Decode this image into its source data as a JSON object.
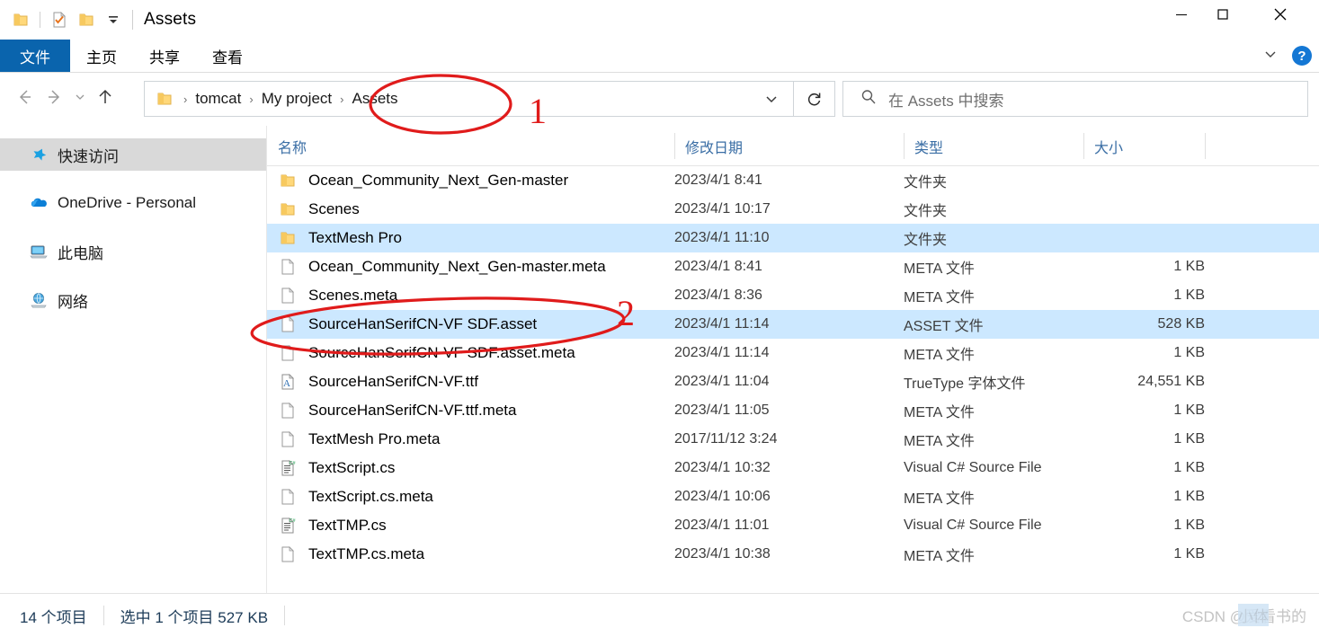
{
  "window": {
    "title": "Assets",
    "controls": {
      "minimize": "—",
      "maximize": "☐",
      "close": "✕"
    },
    "quick_access": {
      "folder_icon": "folder-icon",
      "properties_icon": "properties-icon",
      "new_folder_icon": "new-folder-icon",
      "customize_icon": "customize-dropdown-icon"
    }
  },
  "ribbon": {
    "tabs": [
      {
        "label": "文件",
        "active": true
      },
      {
        "label": "主页",
        "active": false
      },
      {
        "label": "共享",
        "active": false
      },
      {
        "label": "查看",
        "active": false
      }
    ],
    "collapse_icon": "chevron-down-icon",
    "help_label": "?",
    "accent_color": "#0a64ad"
  },
  "nav": {
    "back_icon": "arrow-left-icon",
    "forward_icon": "arrow-right-icon",
    "recent_icon": "chevron-down-icon",
    "up_icon": "arrow-up-icon",
    "breadcrumb": [
      "tomcat",
      "My project",
      "Assets"
    ],
    "breadcrumb_separator": "›",
    "address_dropdown_icon": "chevron-down-icon",
    "refresh_icon": "refresh-icon"
  },
  "search": {
    "icon": "search-icon",
    "placeholder": "在 Assets 中搜索",
    "value": ""
  },
  "sidebar": {
    "items": [
      {
        "label": "快速访问",
        "icon": "pin-star-icon",
        "selected": true
      },
      {
        "label": "OneDrive - Personal",
        "icon": "onedrive-cloud-icon",
        "selected": false
      },
      {
        "label": "此电脑",
        "icon": "this-pc-icon",
        "selected": false
      },
      {
        "label": "网络",
        "icon": "network-icon",
        "selected": false
      }
    ]
  },
  "filelist": {
    "columns": [
      {
        "key": "name",
        "label": "名称"
      },
      {
        "key": "date",
        "label": "修改日期"
      },
      {
        "key": "type",
        "label": "类型"
      },
      {
        "key": "size",
        "label": "大小"
      }
    ],
    "rows": [
      {
        "name": "Ocean_Community_Next_Gen-master",
        "date": "2023/4/1 8:41",
        "type": "文件夹",
        "size": "",
        "icon": "folder-icon",
        "selected": false
      },
      {
        "name": "Scenes",
        "date": "2023/4/1 10:17",
        "type": "文件夹",
        "size": "",
        "icon": "folder-icon",
        "selected": false
      },
      {
        "name": "TextMesh Pro",
        "date": "2023/4/1 11:10",
        "type": "文件夹",
        "size": "",
        "icon": "folder-icon",
        "selected": true
      },
      {
        "name": "Ocean_Community_Next_Gen-master.meta",
        "date": "2023/4/1 8:41",
        "type": "META 文件",
        "size": "1 KB",
        "icon": "generic-file-icon",
        "selected": false
      },
      {
        "name": "Scenes.meta",
        "date": "2023/4/1 8:36",
        "type": "META 文件",
        "size": "1 KB",
        "icon": "generic-file-icon",
        "selected": false
      },
      {
        "name": "SourceHanSerifCN-VF SDF.asset",
        "date": "2023/4/1 11:14",
        "type": "ASSET 文件",
        "size": "528 KB",
        "icon": "generic-file-icon",
        "selected": true
      },
      {
        "name": "SourceHanSerifCN-VF SDF.asset.meta",
        "date": "2023/4/1 11:14",
        "type": "META 文件",
        "size": "1 KB",
        "icon": "generic-file-icon",
        "selected": false
      },
      {
        "name": "SourceHanSerifCN-VF.ttf",
        "date": "2023/4/1 11:04",
        "type": "TrueType 字体文件",
        "size": "24,551 KB",
        "icon": "font-file-icon",
        "selected": false
      },
      {
        "name": "SourceHanSerifCN-VF.ttf.meta",
        "date": "2023/4/1 11:05",
        "type": "META 文件",
        "size": "1 KB",
        "icon": "generic-file-icon",
        "selected": false
      },
      {
        "name": "TextMesh Pro.meta",
        "date": "2017/11/12 3:24",
        "type": "META 文件",
        "size": "1 KB",
        "icon": "generic-file-icon",
        "selected": false
      },
      {
        "name": "TextScript.cs",
        "date": "2023/4/1 10:32",
        "type": "Visual C# Source File",
        "size": "1 KB",
        "icon": "csharp-file-icon",
        "selected": false
      },
      {
        "name": "TextScript.cs.meta",
        "date": "2023/4/1 10:06",
        "type": "META 文件",
        "size": "1 KB",
        "icon": "generic-file-icon",
        "selected": false
      },
      {
        "name": "TextTMP.cs",
        "date": "2023/4/1 11:01",
        "type": "Visual C# Source File",
        "size": "1 KB",
        "icon": "csharp-file-icon",
        "selected": false
      },
      {
        "name": "TextTMP.cs.meta",
        "date": "2023/4/1 10:38",
        "type": "META 文件",
        "size": "1 KB",
        "icon": "generic-file-icon",
        "selected": false
      }
    ],
    "selection_color": "#cce8ff"
  },
  "status": {
    "item_count": "14 个项目",
    "selection": "选中 1 个项目  527 KB"
  },
  "watermark": {
    "text": "CSDN @爱看书的",
    "overlap": "小体"
  },
  "annotations": {
    "color": "#e01b1b",
    "marks": [
      {
        "label": "1",
        "target": "breadcrumb-assets"
      },
      {
        "label": "2",
        "target": "row-sourcehanserifcn-vf-sdf-asset"
      }
    ]
  }
}
